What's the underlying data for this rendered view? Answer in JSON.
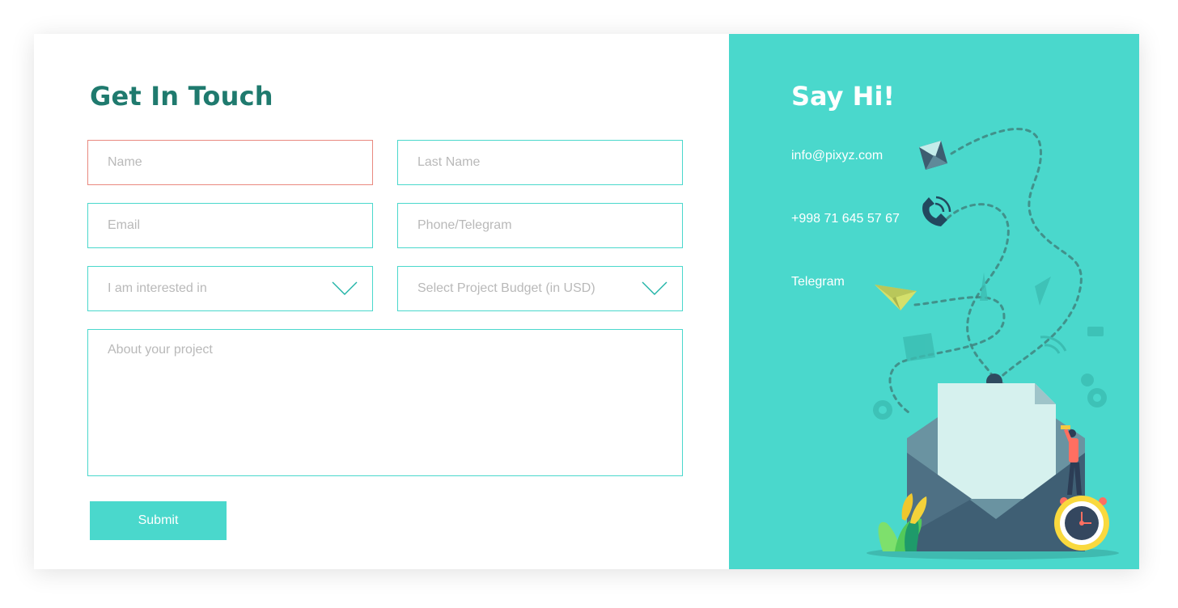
{
  "form": {
    "title": "Get In Touch",
    "name_placeholder": "Name",
    "last_name_placeholder": "Last Name",
    "email_placeholder": "Email",
    "phone_placeholder": "Phone/Telegram",
    "interest_placeholder": "I am interested in",
    "budget_placeholder": "Select Project Budget (in USD)",
    "about_placeholder": "About your project",
    "submit_label": "Submit"
  },
  "contact": {
    "title": "Say Hi!",
    "email": "info@pixyz.com",
    "phone": "+998 71 645 57 67",
    "telegram": "Telegram"
  },
  "colors": {
    "accent": "#4ad8cc",
    "title": "#1f7a6e",
    "error_border": "#e9897f",
    "placeholder": "#b9b9b9"
  },
  "icons": [
    "chevron-down-icon",
    "mail-icon",
    "phone-icon",
    "paper-plane-icon"
  ]
}
